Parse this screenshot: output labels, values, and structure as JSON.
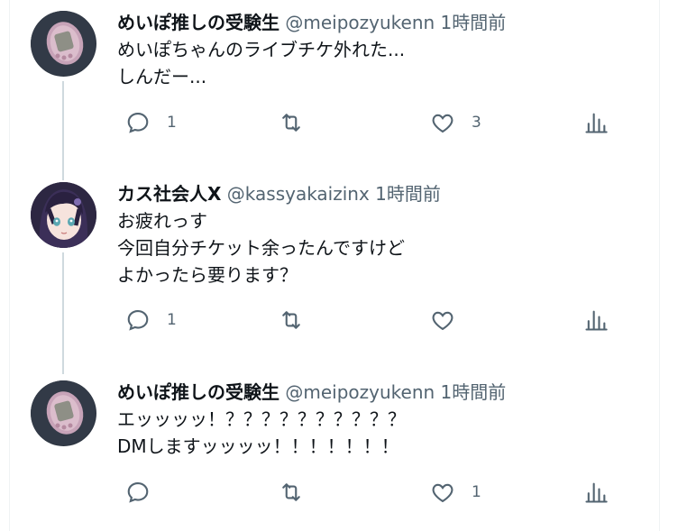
{
  "colors": {
    "text": "#0f1419",
    "secondary": "#536471",
    "thread_line": "#cfd9de"
  },
  "tweets": [
    {
      "name": "めいぽ推しの受験生",
      "handle": "@meipozyukenn",
      "time": "1時間前",
      "avatar": "tamagotchi-avatar",
      "lines": [
        "めいぽちゃんのライブチケ外れた...",
        "しんだー..."
      ],
      "reply_count": "1",
      "retweet_count": "",
      "like_count": "3"
    },
    {
      "name": "カス社会人X",
      "handle": "@kassyakaizinx",
      "time": "1時間前",
      "avatar": "anime-girl-avatar",
      "lines": [
        "お疲れっす",
        "今回自分チケット余ったんですけど",
        "よかったら要ります？"
      ],
      "reply_count": "1",
      "retweet_count": "",
      "like_count": ""
    },
    {
      "name": "めいぽ推しの受験生",
      "handle": "@meipozyukenn",
      "time": "1時間前",
      "avatar": "tamagotchi-avatar",
      "lines": [
        "エッッッッ！？？？？？？？？？？",
        "DMしますッッッッ！！！！！！！"
      ],
      "reply_count": "",
      "retweet_count": "",
      "like_count": "1"
    }
  ]
}
